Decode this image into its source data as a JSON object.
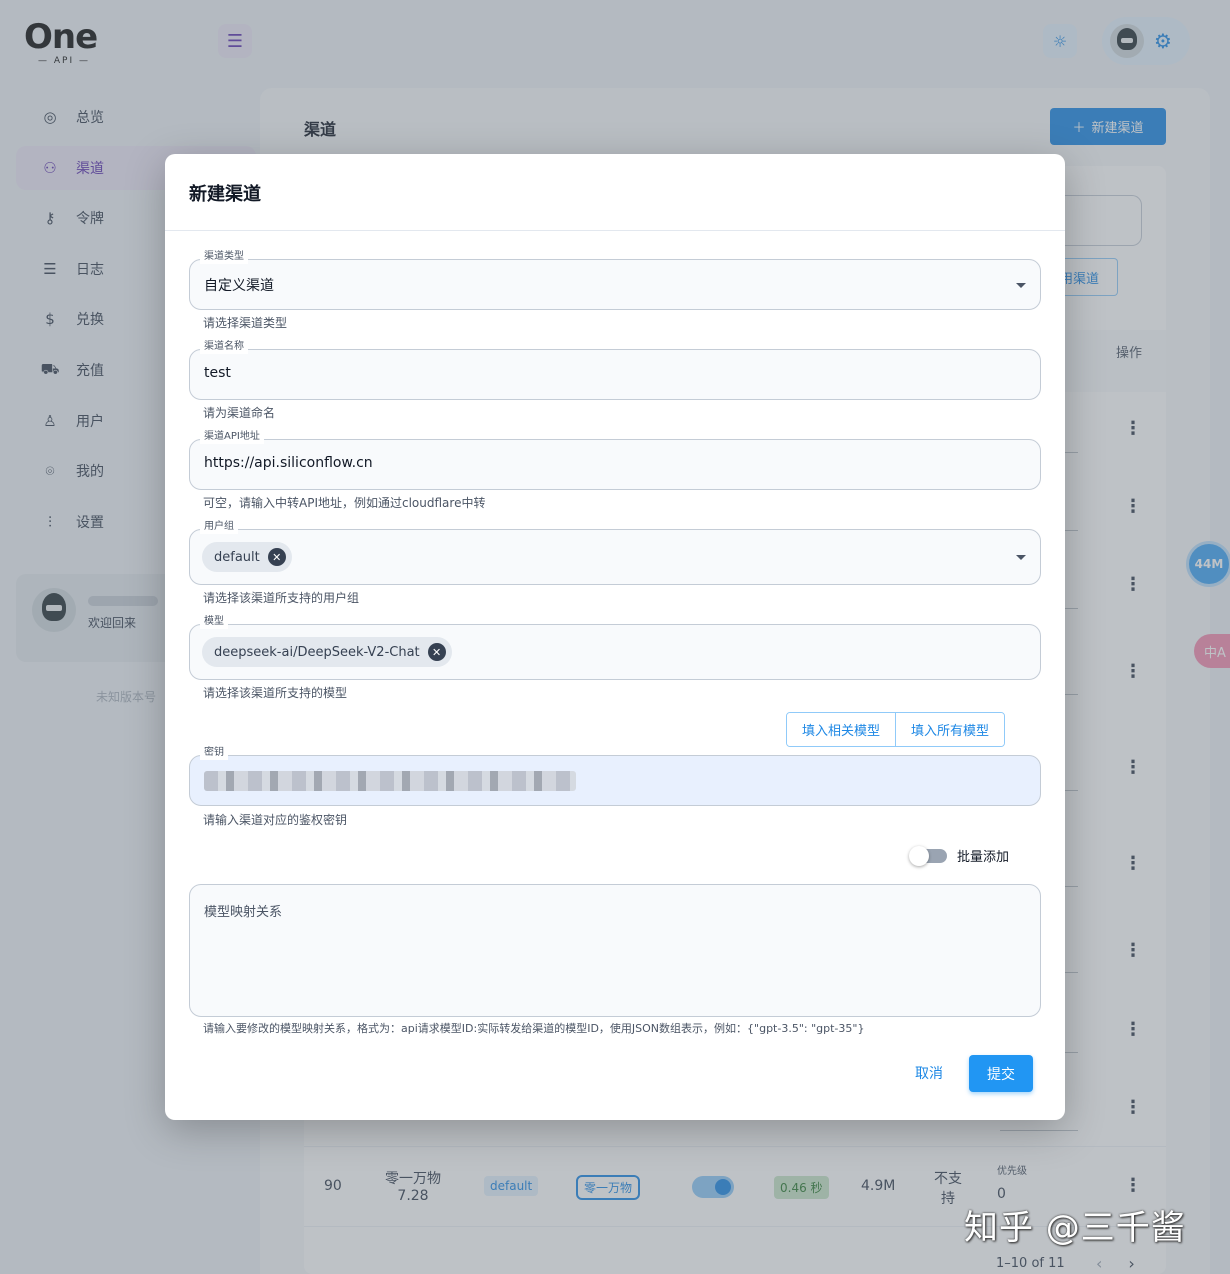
{
  "app": {
    "logo_text": "One",
    "logo_sub": "— API —",
    "sidebar": [
      {
        "label": "总览",
        "icon": "dashboard-icon"
      },
      {
        "label": "渠道",
        "icon": "sitemap-icon",
        "active": true
      },
      {
        "label": "令牌",
        "icon": "key-icon"
      },
      {
        "label": "日志",
        "icon": "log-icon"
      },
      {
        "label": "兑换",
        "icon": "currency-icon"
      },
      {
        "label": "充值",
        "icon": "cart-icon"
      },
      {
        "label": "用户",
        "icon": "user-icon"
      },
      {
        "label": "我的",
        "icon": "profile-scan-icon"
      },
      {
        "label": "设置",
        "icon": "sliders-icon"
      }
    ],
    "welcome": "欢迎回来",
    "version": "未知版本号"
  },
  "page": {
    "title": "渠道",
    "new_channel_label": "新建渠道",
    "partial_button_label": "用渠道",
    "operations_header": "操作",
    "last_row": {
      "id": "90",
      "name_line1": "零一万物",
      "name_line2": "7.28",
      "group": "default",
      "type": "零一万物",
      "response_time": "0.46 秒",
      "balance": "4.9M",
      "support_line1": "不支",
      "support_line2": "持",
      "priority_label": "优先级",
      "priority_value": "0"
    },
    "partial_row_text": "7.28",
    "partial_row_text2": "持",
    "pagination": "1–10 of 11"
  },
  "floating": {
    "memory": "44M",
    "translate": "中A"
  },
  "watermark": "知乎 @三千酱",
  "dialog": {
    "title": "新建渠道",
    "channel_type": {
      "label": "渠道类型",
      "value": "自定义渠道",
      "helper": "请选择渠道类型"
    },
    "channel_name": {
      "label": "渠道名称",
      "value": "test",
      "helper": "请为渠道命名"
    },
    "api_base": {
      "label": "渠道API地址",
      "value": "https://api.siliconflow.cn",
      "helper": "可空，请输入中转API地址，例如通过cloudflare中转"
    },
    "user_group": {
      "label": "用户组",
      "chips": [
        "default"
      ],
      "helper": "请选择该渠道所支持的用户组"
    },
    "models": {
      "label": "模型",
      "chips": [
        "deepseek-ai/DeepSeek-V2-Chat"
      ],
      "helper": "请选择该渠道所支持的模型"
    },
    "fill_related_label": "填入相关模型",
    "fill_all_label": "填入所有模型",
    "key": {
      "label": "密钥",
      "helper": "请输入渠道对应的鉴权密钥"
    },
    "batch_add_label": "批量添加",
    "batch_add_on": false,
    "model_mapping": {
      "placeholder": "模型映射关系",
      "helper": "请输入要修改的模型映射关系，格式为：api请求模型ID:实际转发给渠道的模型ID，使用JSON数组表示，例如：{\"gpt-3.5\": \"gpt-35\"}"
    },
    "cancel_label": "取消",
    "submit_label": "提交"
  },
  "colors": {
    "primary": "#1e88e5",
    "secondary": "#5e35b1",
    "key_field_bg": "#e8f0fe"
  }
}
